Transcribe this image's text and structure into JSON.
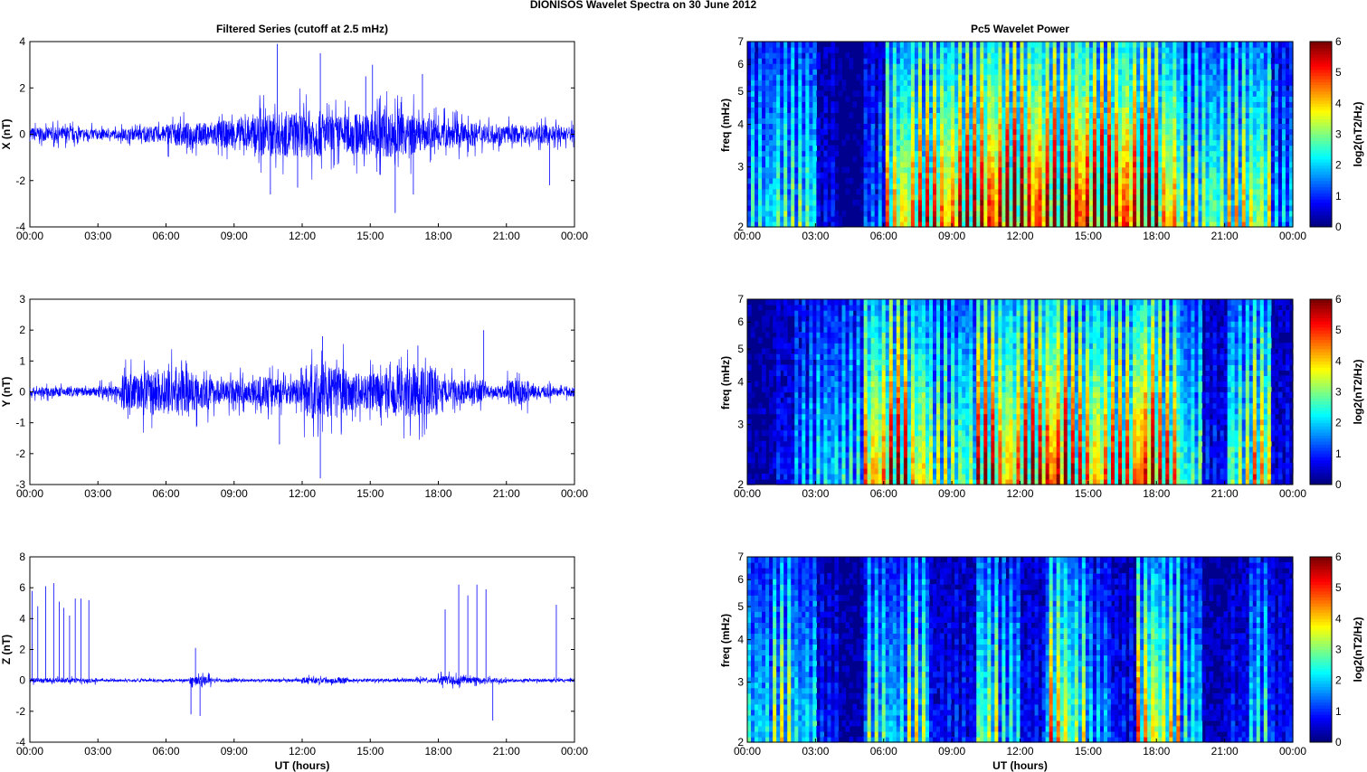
{
  "title": "DIONISOS Wavelet Spectra on 30 June      2012",
  "chart_data": [
    {
      "type": "line",
      "title": "Filtered Series (cutoff at 2.5 mHz)",
      "ylabel": "X (nT)",
      "xlabel": "",
      "ylim": [
        -4,
        4
      ],
      "yticks": [
        -4,
        -2,
        0,
        2,
        4
      ],
      "xticks": [
        "00:00",
        "03:00",
        "06:00",
        "09:00",
        "12:00",
        "15:00",
        "18:00",
        "21:00",
        "00:00"
      ],
      "xlim_hours": [
        0,
        24
      ],
      "hourly_amplitude": [
        0.3,
        0.3,
        0.25,
        0.2,
        0.25,
        0.35,
        0.5,
        0.5,
        0.6,
        0.7,
        0.9,
        1.0,
        1.0,
        0.8,
        0.9,
        1.0,
        0.9,
        0.7,
        0.6,
        0.5,
        0.4,
        0.4,
        0.4,
        0.35
      ],
      "spikes": [
        [
          10.9,
          3.9
        ],
        [
          10.6,
          -2.6
        ],
        [
          12.8,
          3.5
        ],
        [
          11.8,
          -2.3
        ],
        [
          15.1,
          3.0
        ],
        [
          16.1,
          -3.4
        ],
        [
          17.3,
          2.6
        ],
        [
          16.9,
          -2.6
        ],
        [
          22.9,
          -2.2
        ],
        [
          14.8,
          2.5
        ]
      ]
    },
    {
      "type": "line",
      "ylabel": "Y (nT)",
      "xlabel": "",
      "ylim": [
        -3,
        3
      ],
      "yticks": [
        -3,
        -2,
        -1,
        0,
        1,
        2,
        3
      ],
      "xticks": [
        "00:00",
        "03:00",
        "06:00",
        "09:00",
        "12:00",
        "15:00",
        "18:00",
        "21:00",
        "00:00"
      ],
      "xlim_hours": [
        0,
        24
      ],
      "hourly_amplitude": [
        0.15,
        0.15,
        0.15,
        0.2,
        0.6,
        0.7,
        0.7,
        0.6,
        0.4,
        0.4,
        0.5,
        0.4,
        0.9,
        0.8,
        0.6,
        0.6,
        0.8,
        0.8,
        0.4,
        0.4,
        0.2,
        0.4,
        0.2,
        0.15
      ],
      "spikes": [
        [
          12.8,
          -2.8
        ],
        [
          12.9,
          1.8
        ],
        [
          20,
          2.0
        ],
        [
          11,
          -1.7
        ],
        [
          17.1,
          1.5
        ]
      ]
    },
    {
      "type": "line",
      "ylabel": "Z (nT)",
      "xlabel": "UT (hours)",
      "ylim": [
        -4,
        8
      ],
      "yticks": [
        -4,
        -2,
        0,
        2,
        4,
        6,
        8
      ],
      "xticks": [
        "00:00",
        "03:00",
        "06:00",
        "09:00",
        "12:00",
        "15:00",
        "18:00",
        "21:00",
        "00:00"
      ],
      "xlim_hours": [
        0,
        24
      ],
      "hourly_amplitude": [
        0.15,
        0.15,
        0.15,
        0.08,
        0.08,
        0.08,
        0.1,
        0.25,
        0.1,
        0.08,
        0.08,
        0.1,
        0.2,
        0.2,
        0.1,
        0.1,
        0.1,
        0.15,
        0.3,
        0.2,
        0.15,
        0.1,
        0.1,
        0.1
      ],
      "spikes": [
        [
          0.1,
          5.8
        ],
        [
          0.35,
          4.8
        ],
        [
          0.7,
          6.1
        ],
        [
          1.05,
          6.3
        ],
        [
          1.3,
          5.1
        ],
        [
          1.5,
          4.7
        ],
        [
          1.75,
          4.2
        ],
        [
          2.0,
          5.3
        ],
        [
          2.25,
          5.3
        ],
        [
          2.6,
          5.2
        ],
        [
          7.3,
          2.1
        ],
        [
          7.1,
          -2.2
        ],
        [
          7.5,
          -2.3
        ],
        [
          18.3,
          4.6
        ],
        [
          18.9,
          6.2
        ],
        [
          19.3,
          5.5
        ],
        [
          19.7,
          6.2
        ],
        [
          20.1,
          5.9
        ],
        [
          20.4,
          -2.6
        ],
        [
          23.2,
          4.9
        ]
      ]
    },
    {
      "type": "heatmap",
      "title": "Pc5 Wavelet Power",
      "ylabel": "freq (mHz)",
      "xlabel": "",
      "yticks": [
        2,
        3,
        4,
        5,
        6,
        7
      ],
      "ylim": [
        2,
        7
      ],
      "colorbar_label": "log2(nT2/Hz)",
      "colorbar_ticks": [
        0,
        1,
        2,
        3,
        4,
        5,
        6
      ],
      "xticks": [
        "00:00",
        "03:00",
        "06:00",
        "09:00",
        "12:00",
        "15:00",
        "18:00",
        "21:00",
        "00:00"
      ],
      "hourly_power": [
        2.5,
        3,
        3,
        0.8,
        0,
        1.5,
        4.5,
        5,
        5.2,
        5.5,
        6,
        6,
        6,
        6,
        6.2,
        6,
        6,
        6,
        5,
        3.5,
        3.5,
        4,
        4,
        2
      ]
    },
    {
      "type": "heatmap",
      "ylabel": "freq (mHz)",
      "xlabel": "",
      "yticks": [
        2,
        3,
        4,
        5,
        6,
        7
      ],
      "ylim": [
        2,
        7
      ],
      "colorbar_label": "log2(nT2/Hz)",
      "colorbar_ticks": [
        0,
        1,
        2,
        3,
        4,
        5,
        6
      ],
      "xticks": [
        "00:00",
        "03:00",
        "06:00",
        "09:00",
        "12:00",
        "15:00",
        "18:00",
        "21:00",
        "00:00"
      ],
      "hourly_power": [
        0.3,
        1,
        2,
        2.5,
        2.5,
        5,
        5.5,
        4.5,
        3.5,
        3.5,
        5.5,
        5,
        5.5,
        6,
        5,
        5,
        5,
        6,
        5,
        3,
        1,
        3.5,
        4.5,
        0.8
      ]
    },
    {
      "type": "heatmap",
      "ylabel": "freq (mHz)",
      "xlabel": "UT (hours)",
      "yticks": [
        2,
        3,
        4,
        5,
        6,
        7
      ],
      "ylim": [
        2,
        7
      ],
      "colorbar_label": "log2(nT2/Hz)",
      "colorbar_ticks": [
        0,
        1,
        2,
        3,
        4,
        5,
        6
      ],
      "xticks": [
        "00:00",
        "03:00",
        "06:00",
        "09:00",
        "12:00",
        "15:00",
        "18:00",
        "21:00",
        "00:00"
      ],
      "hourly_power": [
        2.5,
        3.5,
        2.5,
        1,
        0.3,
        3,
        2.5,
        3.5,
        1,
        1,
        3.5,
        2.5,
        1,
        4.5,
        3.5,
        2,
        1,
        4.5,
        4,
        2.5,
        0.5,
        1,
        2.5,
        1
      ]
    }
  ]
}
